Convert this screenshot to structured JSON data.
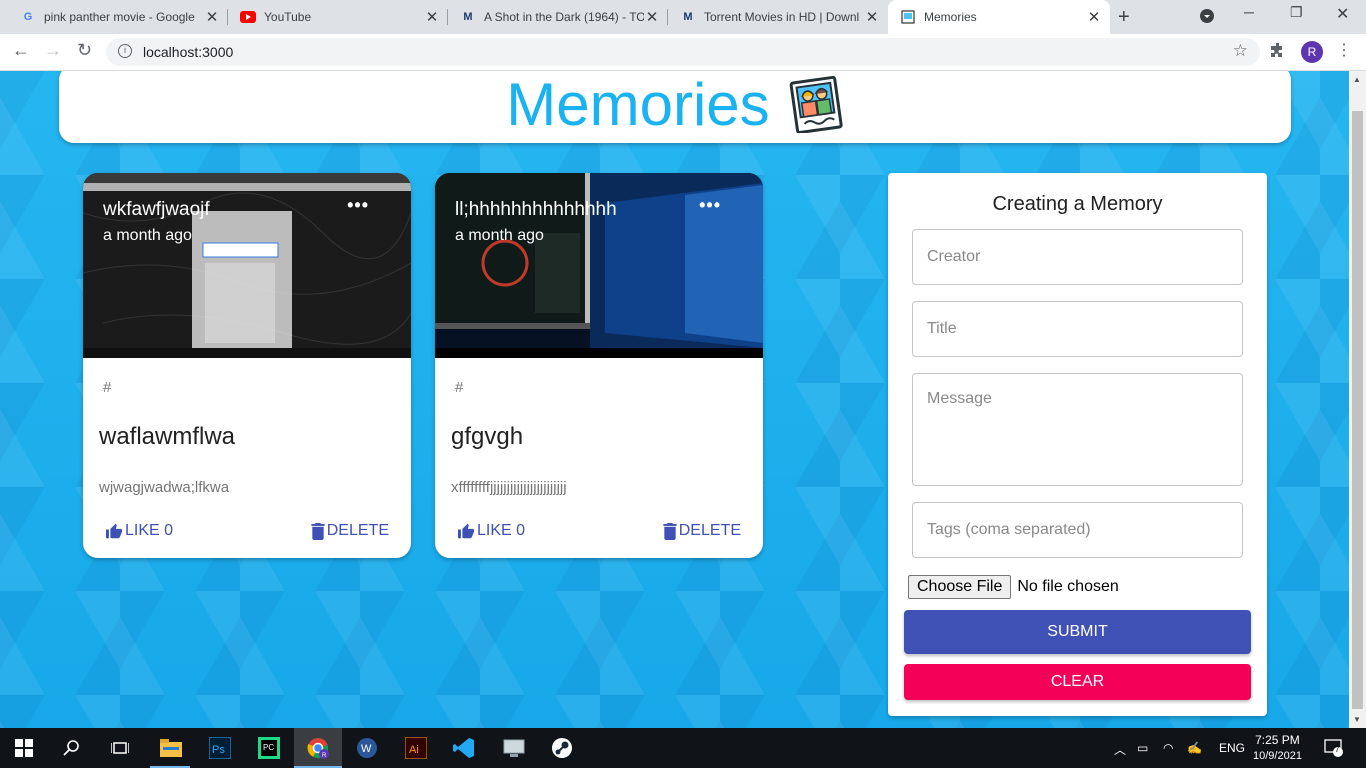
{
  "browser": {
    "tabs": [
      {
        "title": "pink panther movie - Google",
        "icon": "google-icon"
      },
      {
        "title": "YouTube",
        "icon": "youtube-icon"
      },
      {
        "title": "A Shot in the Dark (1964) - TO",
        "icon": "m-logo-icon"
      },
      {
        "title": "Torrent Movies in HD | Downl",
        "icon": "m-logo-icon"
      },
      {
        "title": "Memories",
        "icon": "memories-favicon"
      }
    ],
    "address": "localhost:3000",
    "profile_initial": "R"
  },
  "app": {
    "heading": "Memories",
    "accent_color": "#1ab2f0"
  },
  "posts": [
    {
      "creator": "wkfawfjwaojf",
      "time": "a month ago",
      "tags": "#",
      "title": "waflawmflwa",
      "message": "wjwagjwadwa;lfkwa",
      "like_label": "LIKE 0",
      "delete_label": "DELETE",
      "more": "•••"
    },
    {
      "creator": "ll;hhhhhhhhhhhhhh",
      "time": "a month ago",
      "tags": "#",
      "title": "gfgvgh",
      "message": "xffffffffjjjjjjjjjjjjjjjjjjjjjjj",
      "like_label": "LIKE 0",
      "delete_label": "DELETE",
      "more": "•••"
    }
  ],
  "form": {
    "title": "Creating a Memory",
    "creator_placeholder": "Creator",
    "title_placeholder": "Title",
    "message_placeholder": "Message",
    "tags_placeholder": "Tags (coma separated)",
    "file_button": "Choose File",
    "file_status": "No file chosen",
    "submit_label": "SUBMIT",
    "clear_label": "CLEAR",
    "submit_color": "#3f51b5",
    "clear_color": "#f50057"
  },
  "taskbar": {
    "language": "ENG",
    "time": "7:25 PM",
    "date": "10/9/2021",
    "notifications": "7"
  }
}
